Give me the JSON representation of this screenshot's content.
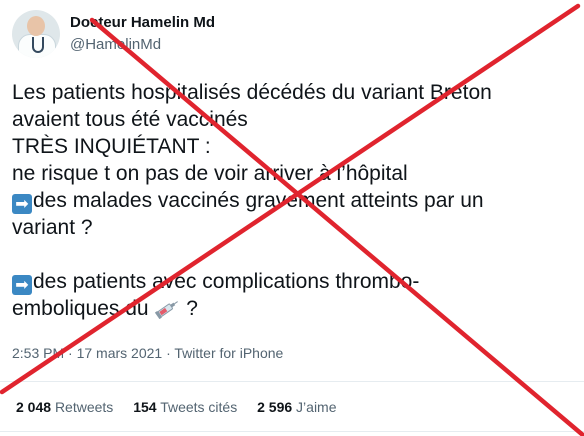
{
  "author": {
    "name": "Docteur Hamelin Md",
    "handle": "@HamelinMd"
  },
  "tweet": {
    "lines": [
      "Les patients hospitalisés décédés du variant Breton",
      "avaient tous été vaccinés",
      "TRÈS INQUIÉTANT :",
      "ne risque t on pas de voir arriver à l’hôpital",
      "des malades vaccinés gravement atteints par un",
      "variant ?",
      "des patients avec complications thrombo-",
      "emboliques du",
      "?"
    ],
    "emoji": {
      "arrow": "➡",
      "syringe": "syringe-emoji"
    },
    "time": "2:53 PM · 17 mars 2021 · Twitter for iPhone"
  },
  "stats": {
    "retweets_count": "2 048",
    "retweets_label": "Retweets",
    "quotes_count": "154",
    "quotes_label": "Tweets cités",
    "likes_count": "2 596",
    "likes_label": "J’aime"
  },
  "overlay": {
    "cross_color": "#e0242e"
  }
}
